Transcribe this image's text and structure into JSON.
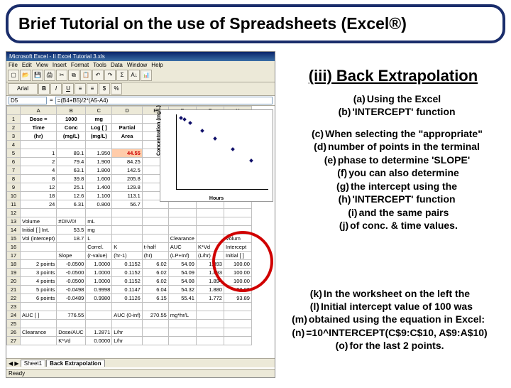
{
  "title": "Brief Tutorial on the use of Spreadsheets (Excel®)",
  "section": "(iii) Back Extrapolation",
  "bullets_a": [
    {
      "t": "(a)",
      "x": "Using the Excel"
    },
    {
      "t": "(b)",
      "x": "'INTERCEPT' function"
    }
  ],
  "bullets_b": [
    {
      "t": "(c)",
      "x": "When selecting the \"appropriate\""
    },
    {
      "t": "(d)",
      "x": "number of points in the terminal"
    },
    {
      "t": "(e)",
      "x": "phase to determine 'SLOPE'"
    },
    {
      "t": "(f)",
      "x": "you can also determine"
    },
    {
      "t": "(g)",
      "x": "the intercept using the"
    },
    {
      "t": "(h)",
      "x": "'INTERCEPT' function"
    },
    {
      "t": "(i)",
      "x": "and the same pairs"
    },
    {
      "t": "(j)",
      "x": "of conc. & time values."
    }
  ],
  "bullets_c": [
    {
      "t": "(k)",
      "x": "In the worksheet on the left the"
    },
    {
      "t": "(l)",
      "x": "Initial intercept value of 100 was"
    },
    {
      "t": "(m)",
      "x": "obtained using the equation in Excel:"
    },
    {
      "t": "(n)",
      "x": "=10^INTERCEPT(C$9:C$10, A$9:A$10)"
    },
    {
      "t": "(o)",
      "x": "for the last 2 points."
    }
  ],
  "excel": {
    "title": "Microsoft Excel - II Excel Tutorial 3.xls",
    "menu": [
      "File",
      "Edit",
      "View",
      "Insert",
      "Format",
      "Tools",
      "Data",
      "Window",
      "Help"
    ],
    "cell_ref": "D5",
    "formula": "=(B4+B5)/2*(A5-A4)",
    "cols": [
      "",
      "A",
      "B",
      "C",
      "D",
      "E",
      "F",
      "G",
      "H"
    ],
    "rows": [
      [
        "1",
        "Dose =",
        "1000",
        "mg",
        "",
        "",
        "",
        "",
        ""
      ],
      [
        "2",
        "Time",
        "Conc",
        "Log [ ]",
        "Partial",
        "",
        "",
        "",
        ""
      ],
      [
        "3",
        "(hr)",
        "(mg/L)",
        "(mg/L)",
        "Area",
        "",
        "",
        "",
        ""
      ],
      [
        "4",
        "",
        "",
        "",
        "",
        "",
        "",
        "",
        ""
      ],
      [
        "5",
        "1",
        "89.1",
        "1.950",
        "44.55",
        "",
        "",
        "",
        ""
      ],
      [
        "6",
        "2",
        "79.4",
        "1.900",
        "84.25",
        "",
        "",
        "",
        ""
      ],
      [
        "7",
        "4",
        "63.1",
        "1.800",
        "142.5",
        "",
        "",
        "",
        ""
      ],
      [
        "8",
        "8",
        "39.8",
        "1.600",
        "205.8",
        "",
        "",
        "",
        ""
      ],
      [
        "9",
        "12",
        "25.1",
        "1.400",
        "129.8",
        "",
        "",
        "",
        ""
      ],
      [
        "10",
        "18",
        "12.6",
        "1.100",
        "113.1",
        "",
        "",
        "",
        ""
      ],
      [
        "11",
        "24",
        "6.31",
        "0.800",
        "56.7",
        "",
        "",
        "",
        ""
      ],
      [
        "12",
        "",
        "",
        "",
        "",
        "",
        "",
        "",
        ""
      ],
      [
        "13",
        "Volume",
        "#DIV/0!",
        "mL",
        "",
        "",
        "",
        "",
        ""
      ],
      [
        "14",
        "Initial [ ] Int.",
        "53.5",
        "mg",
        "",
        "",
        "",
        "",
        ""
      ],
      [
        "15",
        "Vol (intercept)",
        "18.7",
        "L",
        "",
        "",
        "Clearance",
        "",
        "Volum"
      ],
      [
        "16",
        "",
        "",
        "Correl.",
        "K",
        "t-half",
        "AUC",
        "K*Vd",
        "Intercept"
      ],
      [
        "17",
        "",
        "Slope",
        "(r-value)",
        "(hr-1)",
        "(hr)",
        "(LP+Inf)",
        "(L/hr)",
        "Initial [ ]"
      ],
      [
        "18",
        "2 points",
        "-0.0500",
        "1.0000",
        "0.1152",
        "6.02",
        "54.09",
        "1.893",
        "100.00"
      ],
      [
        "19",
        "3 points",
        "-0.0500",
        "1.0000",
        "0.1152",
        "6.02",
        "54.09",
        "1.893",
        "100.00"
      ],
      [
        "20",
        "4 points",
        "-0.0500",
        "1.0000",
        "0.1152",
        "6.02",
        "54.08",
        "1.894",
        "100.00"
      ],
      [
        "21",
        "5 points",
        "-0.0498",
        "0.9998",
        "0.1147",
        "6.04",
        "54.32",
        "1.880",
        "98.80"
      ],
      [
        "22",
        "6 points",
        "-0.0489",
        "0.9980",
        "0.1126",
        "6.15",
        "55.41",
        "1.772",
        "93.89"
      ],
      [
        "23",
        "",
        "",
        "",
        "",
        "",
        "",
        "",
        ""
      ],
      [
        "24",
        "AUC [ ]",
        "776.55",
        "",
        "AUC (0-inf)",
        "270.55",
        "mg*hr/L",
        "",
        ""
      ],
      [
        "25",
        "",
        "",
        "",
        "",
        "",
        "",
        "",
        ""
      ],
      [
        "26",
        "Clearance",
        "Dose/AUC",
        "1.2871",
        "L/hr",
        "",
        "",
        "",
        ""
      ],
      [
        "27",
        "",
        "K*Vd",
        "0.0000",
        "L/hr",
        "",
        "",
        "",
        ""
      ]
    ],
    "highlight_cell": {
      "row": 4,
      "col": 4
    },
    "tabs": [
      "Sheet1",
      "Back Extrapolation"
    ],
    "active_tab": 1,
    "status": "Ready"
  },
  "chart_data": {
    "type": "scatter",
    "x": [
      1,
      2,
      4,
      8,
      12,
      18,
      24
    ],
    "y": [
      89.1,
      79.4,
      63.1,
      39.8,
      25.1,
      12.6,
      6.31
    ],
    "xlabel": "Hours",
    "ylabel": "Concentration (mg/L)",
    "xlim": [
      0,
      30
    ],
    "ylim": [
      0,
      100
    ],
    "yscale_display": "log-look"
  }
}
